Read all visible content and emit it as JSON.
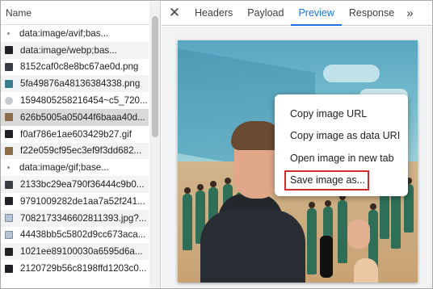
{
  "list": {
    "header": "Name",
    "rows": [
      {
        "name": "data:image/avif;bas...",
        "icon": "dot",
        "alt": false
      },
      {
        "name": "data:image/webp;bas...",
        "icon": "black",
        "alt": true
      },
      {
        "name": "8152caf0c8e8bc67ae0d.png",
        "icon": "dark",
        "alt": false
      },
      {
        "name": "5fa49876a48136384338.png",
        "icon": "teal",
        "alt": true
      },
      {
        "name": "1594805258216454~c5_720...",
        "icon": "cloud",
        "alt": false
      },
      {
        "name": "626b5005a05044f6baaa40d...",
        "icon": "brown",
        "alt": false,
        "selected": true
      },
      {
        "name": "f0af786e1ae603429b27.gif",
        "icon": "black",
        "alt": false
      },
      {
        "name": "f22e059cf95ec3ef9f3dd682...",
        "icon": "brown",
        "alt": true
      },
      {
        "name": "data:image/gif;base...",
        "icon": "dot",
        "alt": false
      },
      {
        "name": "2133bc29ea790f36444c9b0...",
        "icon": "dark",
        "alt": true
      },
      {
        "name": "9791009282de1aa7a52f241...",
        "icon": "black",
        "alt": false
      },
      {
        "name": "7082173346602811393.jpg?...",
        "icon": "img",
        "alt": true
      },
      {
        "name": "44438bb5c5802d9cc673aca...",
        "icon": "img",
        "alt": false
      },
      {
        "name": "1021ee89100030a6595d6a...",
        "icon": "black",
        "alt": true
      },
      {
        "name": "2120729b56c8198ffd1203c0...",
        "icon": "black",
        "alt": false
      }
    ]
  },
  "panel": {
    "close_glyph": "✕",
    "tabs": [
      {
        "label": "Headers",
        "active": false
      },
      {
        "label": "Payload",
        "active": false
      },
      {
        "label": "Preview",
        "active": true
      },
      {
        "label": "Response",
        "active": false
      }
    ],
    "more_glyph": "»"
  },
  "context_menu": {
    "items": [
      {
        "label": "Copy image URL"
      },
      {
        "label": "Copy image as data URI"
      },
      {
        "label": "Open image in new tab"
      },
      {
        "label": "Save image as..."
      }
    ],
    "highlighted_item": "Save image as...",
    "highlight_color": "#d22b2b"
  },
  "colors": {
    "accent": "#1a73e8",
    "selected_row": "#d9d9d9",
    "alt_row": "#f1f3f4"
  }
}
